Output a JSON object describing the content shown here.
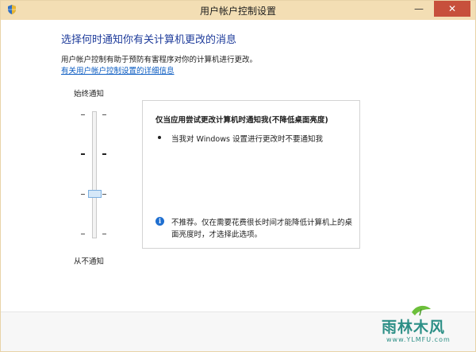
{
  "window": {
    "title": "用户帐户控制设置",
    "minimize_label": "—",
    "close_label": "✕"
  },
  "main": {
    "heading": "选择何时通知你有关计算机更改的消息",
    "description": "用户帐户控制有助于预防有害程序对你的计算机进行更改。",
    "learn_more_link": "有关用户帐户控制设置的详细信息"
  },
  "slider": {
    "label_top": "始终通知",
    "label_bottom": "从不通知",
    "levels": 4,
    "selected_level": 3
  },
  "info_panel": {
    "title": "仅当应用尝试更改计算机时通知我(不降低桌面亮度)",
    "bullet": "当我对 Windows 设置进行更改时不要通知我",
    "note_icon": "i",
    "note": "不推荐。仅在需要花费很长时间才能降低计算机上的桌面亮度时，才选择此选项。"
  },
  "watermark": {
    "logo_text": "雨林木风",
    "url": "www.YLMFU.com"
  },
  "icons": {
    "app_icon": "shield-icon",
    "info_icon": "info-icon"
  }
}
